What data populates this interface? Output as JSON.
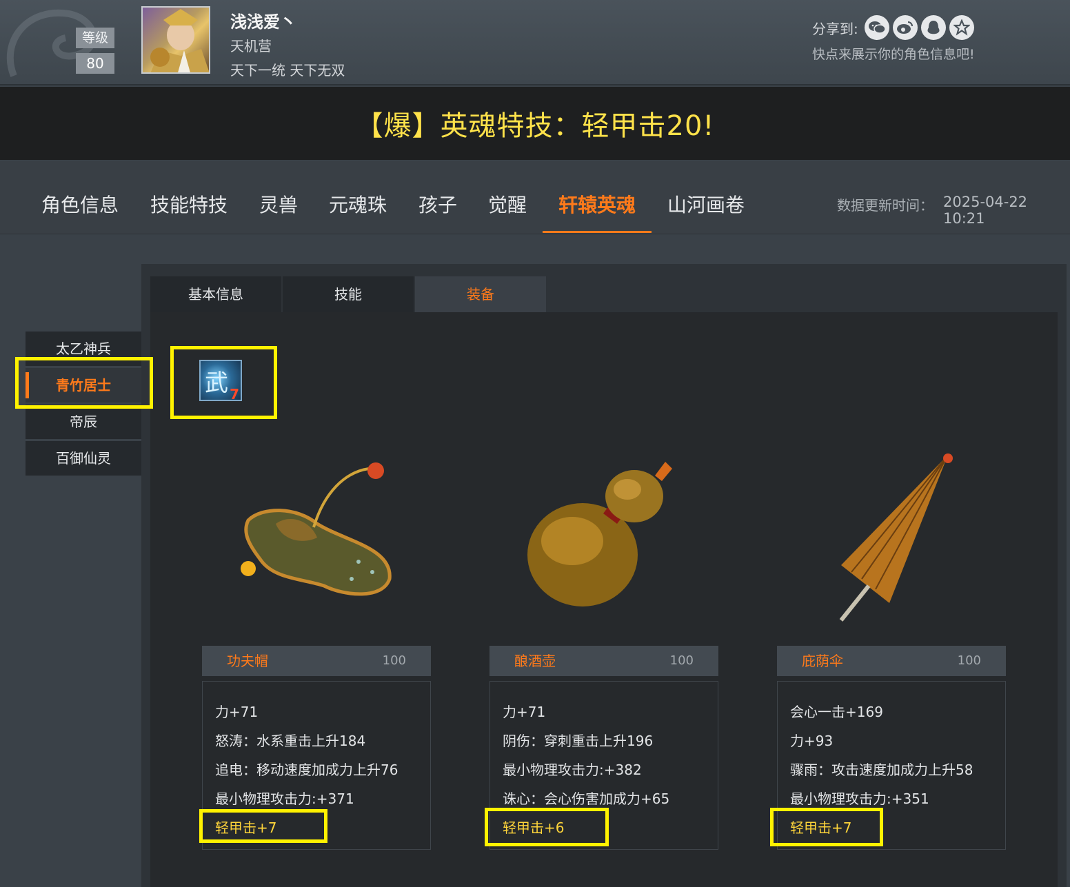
{
  "header": {
    "level_label": "等级",
    "level_value": "80",
    "player_name": "浅浅爱丶",
    "server": "天机营",
    "guild": "天下一统 天下无双",
    "share_label": "分享到:",
    "share_icons": [
      "wechat-icon",
      "weibo-icon",
      "qq-icon",
      "qzone-icon"
    ],
    "share_tip": "快点来展示你的角色信息吧!"
  },
  "banner": {
    "text": "【爆】英魂特技：轻甲击20!"
  },
  "nav": {
    "tabs": [
      "角色信息",
      "技能特技",
      "灵兽",
      "元魂珠",
      "孩子",
      "觉醒",
      "轩辕英魂",
      "山河画卷"
    ],
    "active": "轩辕英魂",
    "update_label": "数据更新时间：",
    "update_time": "2025-04-22 10:21"
  },
  "subtabs": {
    "items": [
      "基本信息",
      "技能",
      "装备"
    ],
    "active": "装备"
  },
  "side_menu": {
    "items": [
      "太乙神兵",
      "青竹居士",
      "帝辰",
      "百御仙灵"
    ],
    "active": "青竹居士"
  },
  "skill": {
    "glyph": "武",
    "badge": "7"
  },
  "equipment": [
    {
      "name": "功夫帽",
      "level": "100",
      "stats": [
        "力+71",
        "怒涛：水系重击上升184",
        "追电：移动速度加成力上升76",
        "最小物理攻击力:+371"
      ],
      "special": "轻甲击+7"
    },
    {
      "name": "酿酒壶",
      "level": "100",
      "stats": [
        "力+71",
        "阴伤：穿刺重击上升196",
        "最小物理攻击力:+382",
        "诛心：会心伤害加成力+65"
      ],
      "special": "轻甲击+6"
    },
    {
      "name": "庇荫伞",
      "level": "100",
      "stats": [
        "会心一击+169",
        "力+93",
        "骤雨：攻击速度加成力上升58",
        "最小物理攻击力:+351"
      ],
      "special": "轻甲击+7"
    }
  ],
  "colors": {
    "accent": "#ff7a1a",
    "highlight": "#fff200",
    "banner_text": "#ffe24a",
    "special_stat": "#ffd53a"
  }
}
